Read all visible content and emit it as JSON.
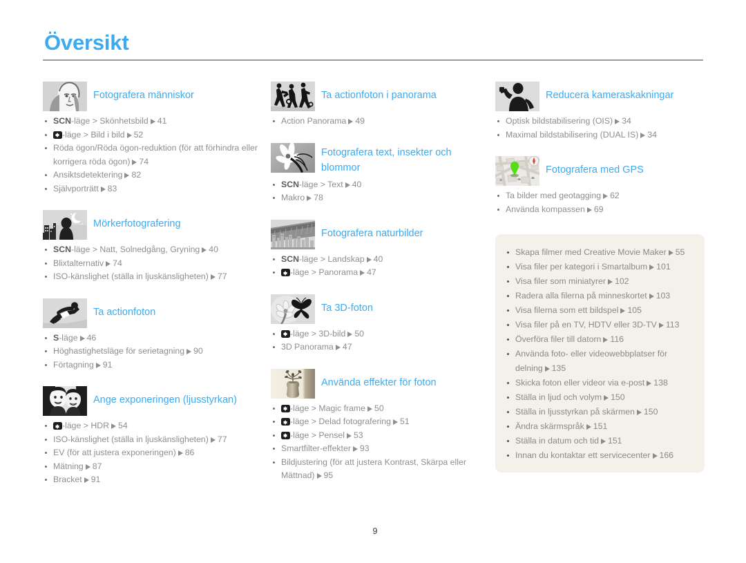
{
  "header": {
    "title": "Översikt"
  },
  "footer": {
    "page_number": "9"
  },
  "colors": {
    "accent": "#3daaf0",
    "body_text": "#8e8e8e",
    "rule": "#9b9b9b",
    "tint_box_bg": "#f3f1ea",
    "icon_bg": "#d6d6d6"
  },
  "columns": [
    {
      "sections": [
        {
          "icon": "portrait-face-icon",
          "title": "Fotografera människor",
          "items": [
            {
              "prefix_bold": "SCN",
              "text": "-läge > Skönhetsbild",
              "page": "41"
            },
            {
              "mode_icon": true,
              "text": "-läge > Bild i bild",
              "page": "52"
            },
            {
              "text": "Röda ögon/Röda ögon-reduktion (för att förhindra eller korrigera röda ögon)",
              "page": "74"
            },
            {
              "text": "Ansiktsdetektering",
              "page": "82"
            },
            {
              "text": "Självporträtt",
              "page": "83"
            }
          ]
        },
        {
          "icon": "night-moon-icon",
          "title": "Mörkerfotografering",
          "items": [
            {
              "prefix_bold": "SCN",
              "text": "-läge > Natt, Solnedgång, Gryning",
              "page": "40"
            },
            {
              "text": "Blixtalternativ",
              "page": "74"
            },
            {
              "text": "ISO-känslighet (ställa in ljuskänsligheten)",
              "page": "77"
            }
          ]
        },
        {
          "icon": "snowboarder-icon",
          "title": "Ta actionfoton",
          "items": [
            {
              "prefix_bold": "S",
              "text": "-läge",
              "page": "46"
            },
            {
              "text": "Höghastighetsläge för serietagning",
              "page": "90"
            },
            {
              "text": "Förtagning",
              "page": "91"
            }
          ]
        },
        {
          "icon": "two-faces-icon",
          "title": "Ange exponeringen (ljusstyrkan)",
          "items": [
            {
              "mode_icon": true,
              "text": "-läge > HDR",
              "page": "54"
            },
            {
              "text": "ISO-känslighet (ställa in ljuskänsligheten)",
              "page": "77"
            },
            {
              "text": "EV (för att justera exponeringen)",
              "page": "86"
            },
            {
              "text": "Mätning",
              "page": "87"
            },
            {
              "text": "Bracket",
              "page": "91"
            }
          ]
        }
      ]
    },
    {
      "sections": [
        {
          "icon": "soccer-players-icon",
          "title": "Ta actionfoton i panorama",
          "items": [
            {
              "text": "Action Panorama",
              "page": "49"
            }
          ]
        },
        {
          "icon": "flower-macro-icon",
          "title": "Fotografera text, insekter och blommor",
          "two_line": true,
          "items": [
            {
              "prefix_bold": "SCN",
              "text": "-läge > Text",
              "page": "40"
            },
            {
              "text": "Makro",
              "page": "78"
            }
          ]
        },
        {
          "icon": "landscape-bridge-icon",
          "title": "Fotografera naturbilder",
          "items": [
            {
              "prefix_bold": "SCN",
              "text": "-läge > Landskap",
              "page": "40"
            },
            {
              "mode_icon": true,
              "text": "-läge > Panorama",
              "page": "47"
            }
          ]
        },
        {
          "icon": "butterfly-3d-icon",
          "title": "Ta 3D-foton",
          "items": [
            {
              "mode_icon": true,
              "text": "-läge > 3D-bild",
              "page": "50"
            },
            {
              "text": "3D Panorama",
              "page": "47"
            }
          ]
        },
        {
          "icon": "vase-effects-icon",
          "title": "Använda effekter för foton",
          "items": [
            {
              "mode_icon": true,
              "text": "-läge > Magic frame",
              "page": "50"
            },
            {
              "mode_icon": true,
              "text": "-läge > Delad fotografering",
              "page": "51"
            },
            {
              "mode_icon": true,
              "text": "-läge > Pensel",
              "page": "53"
            },
            {
              "text": "Smartfilter-effekter",
              "page": "93"
            },
            {
              "text": "Bildjustering (för att justera Kontrast, Skärpa eller Mättnad)",
              "page": "95"
            }
          ]
        }
      ]
    },
    {
      "sections": [
        {
          "icon": "steady-hand-icon",
          "title": "Reducera kameraskakningar",
          "items": [
            {
              "text": "Optisk bildstabilisering (OIS)",
              "page": "34"
            },
            {
              "text": "Maximal bildstabilisering (DUAL IS)",
              "page": "34"
            }
          ]
        },
        {
          "icon": "gps-map-icon",
          "title": "Fotografera med GPS",
          "items": [
            {
              "text": "Ta bilder med geotagging",
              "page": "62"
            },
            {
              "text": "Använda kompassen",
              "page": "69"
            }
          ]
        }
      ],
      "tint_box": {
        "items": [
          {
            "text": "Skapa filmer med Creative Movie Maker",
            "page": "55"
          },
          {
            "text": "Visa filer per kategori i Smartalbum",
            "page": "101"
          },
          {
            "text": "Visa filer som miniatyrer",
            "page": "102"
          },
          {
            "text": "Radera alla filerna på minneskortet",
            "page": "103"
          },
          {
            "text": "Visa filerna som ett bildspel",
            "page": "105"
          },
          {
            "text": "Visa filer på en TV, HDTV eller 3D-TV",
            "page": "113"
          },
          {
            "text": "Överföra filer till datorn",
            "page": "116"
          },
          {
            "text": "Använda foto- eller videowebbplatser för delning",
            "page": "135"
          },
          {
            "text": "Skicka foton eller videor via e-post",
            "page": "138"
          },
          {
            "text": "Ställa in ljud och volym",
            "page": "150"
          },
          {
            "text": "Ställa in ljusstyrkan på skärmen",
            "page": "150"
          },
          {
            "text": "Ändra skärmspråk",
            "page": "151"
          },
          {
            "text": "Ställa in datum och tid",
            "page": "151"
          },
          {
            "text": "Innan du kontaktar ett servicecenter",
            "page": "166"
          }
        ]
      }
    }
  ]
}
